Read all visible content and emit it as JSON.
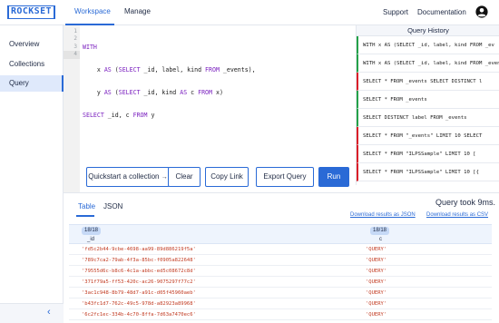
{
  "brand": {
    "logo": "ROCKSET"
  },
  "topnav": {
    "tabs": [
      "Workspace",
      "Manage"
    ],
    "support": "Support",
    "documentation": "Documentation",
    "avatar_icon": "user-avatar-icon"
  },
  "sidebar": {
    "items": [
      "Overview",
      "Collections",
      "Query"
    ],
    "active": "Query",
    "collapse_icon": "chevron-left-icon"
  },
  "editor": {
    "line_numbers": [
      "1",
      "2",
      "3",
      "4"
    ],
    "lines": [
      "WITH",
      "    x AS (SELECT _id, label, kind FROM _events),",
      "    y AS (SELECT _id, kind AS c FROM x)",
      "SELECT _id, c FROM y"
    ]
  },
  "buttons": {
    "quickstart": "Quickstart a collection",
    "clear": "Clear",
    "copy_link": "Copy Link",
    "export_query": "Export Query",
    "run": "Run"
  },
  "history": {
    "title": "Query History",
    "items": [
      {
        "text": "WITH x AS (SELECT _id, label, kind FROM _ev",
        "status": "ok"
      },
      {
        "text": "WITH x AS (SELECT _id, label, kind FROM _even",
        "status": "ok"
      },
      {
        "text": "SELECT * FROM _events SELECT DISTINCT l",
        "status": "err"
      },
      {
        "text": "SELECT * FROM _events",
        "status": "ok"
      },
      {
        "text": "SELECT DISTINCT label FROM _events",
        "status": "ok"
      },
      {
        "text": "SELECT * FROM \"_events\" LIMIT 10 SELECT",
        "status": "err"
      },
      {
        "text": "SELECT * FROM \"ILPSSample\" LIMIT 10 [",
        "status": "err"
      },
      {
        "text": "SELECT * FROM \"ILPSSample\" LIMIT 10 [{",
        "status": "err"
      }
    ],
    "colors": {
      "ok": "#24a148",
      "err": "#da1e28"
    }
  },
  "results": {
    "tabs": [
      "Table",
      "JSON"
    ],
    "query_took": "Query took 9ms.",
    "download_json": "Download results as JSON",
    "download_csv": "Download results as CSV",
    "columns": [
      {
        "badge": "18/18",
        "name": "_id"
      },
      {
        "badge": "18/18",
        "name": "c"
      }
    ],
    "rows": [
      [
        "'fd5c2b44-9cbe-4698-aa99-89d886219f5a'",
        "'QUERY'"
      ],
      [
        "'789c7ca2-79ab-4f3a-85bc-f0905a822648'",
        "'QUERY'"
      ],
      [
        "'79555d6c-b8c6-4c1a-abbc-ed5c08672c8d'",
        "'QUERY'"
      ],
      [
        "'371f79a5-ff53-420c-ac26-9075297f77c2'",
        "'QUERY'"
      ],
      [
        "'3ac1c948-8b79-48d7-a91c-d05f45960aeb'",
        "'QUERY'"
      ],
      [
        "'b43fc1d7-762c-49c5-978d-a82923a89968'",
        "'QUERY'"
      ],
      [
        "'6c2fc1ec-334b-4c70-8ffa-7d63a7470ec6'",
        "'QUERY'"
      ]
    ]
  },
  "accent": "#2a6ad6"
}
